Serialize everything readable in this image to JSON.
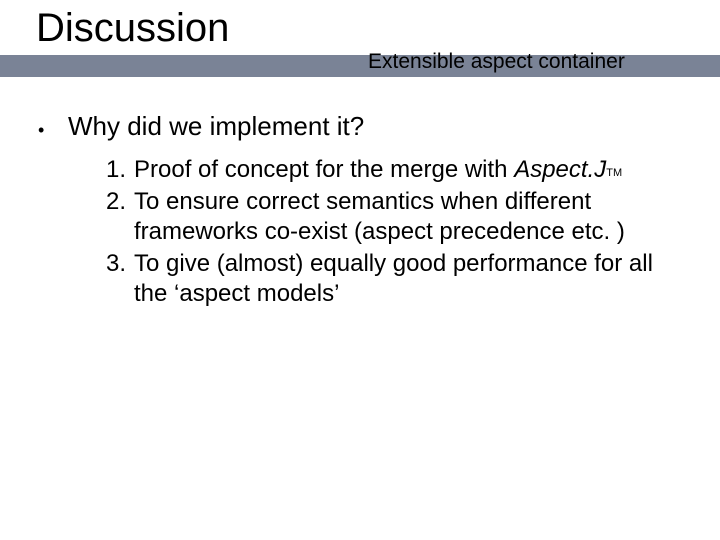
{
  "title": "Discussion",
  "subtitle": "Extensible aspect container",
  "bullet": {
    "marker": "•",
    "text": "Why did we implement it?"
  },
  "list": [
    {
      "num": "1.",
      "text_pre": "Proof of concept for the merge with ",
      "aspectj": "Aspect.J",
      "tm": "TM",
      "text_post": ""
    },
    {
      "num": "2.",
      "text": "To ensure correct semantics when different frameworks co-exist (aspect precedence etc. )"
    },
    {
      "num": "3.",
      "text": "To give (almost) equally good performance for all the ‘aspect models’"
    }
  ]
}
